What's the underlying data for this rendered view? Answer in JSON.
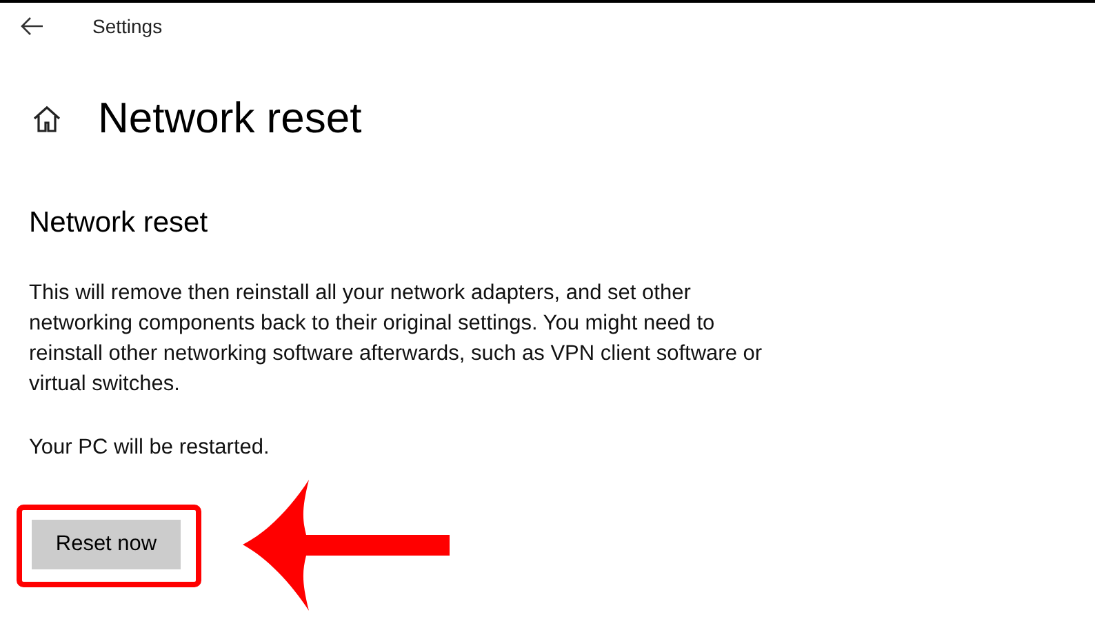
{
  "window": {
    "title": "Settings"
  },
  "page_title": "Network reset",
  "section_title": "Network reset",
  "description": "This will remove then reinstall all your network adapters, and set other networking components back to their original settings. You might need to reinstall other networking software afterwards, such as VPN client software or virtual switches.",
  "note": "Your PC will be restarted.",
  "button": {
    "label": "Reset now"
  }
}
